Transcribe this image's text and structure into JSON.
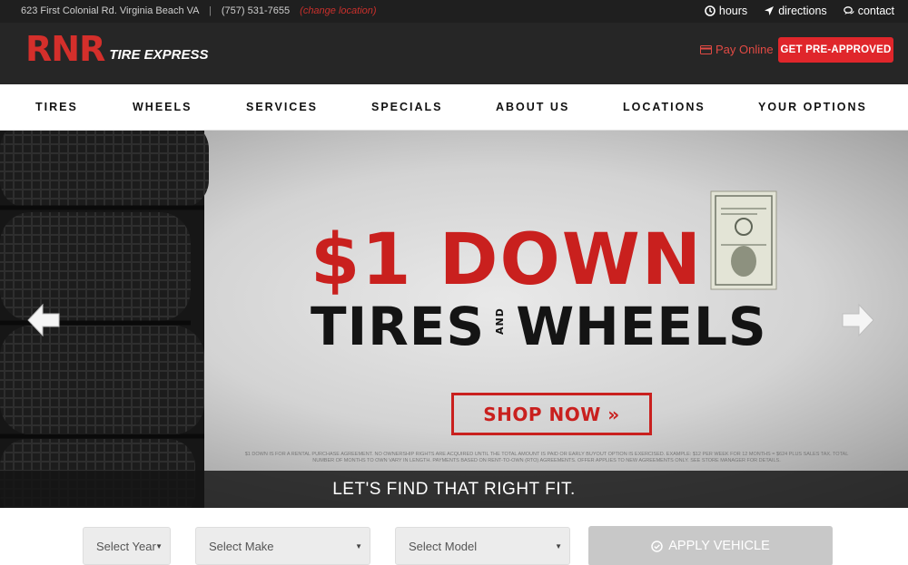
{
  "topbar": {
    "address": "623 First Colonial Rd. Virginia Beach VA",
    "separator": "|",
    "phone": "(757) 531-7655",
    "change_location": "(change location)",
    "links": [
      {
        "label": "hours",
        "icon": "clock-icon"
      },
      {
        "label": "directions",
        "icon": "location-arrow-icon"
      },
      {
        "label": "contact",
        "icon": "chat-icon"
      }
    ]
  },
  "header": {
    "logo_mark": "RNR",
    "logo_text": "TIRE EXPRESS",
    "pay_online": "Pay Online",
    "pre_approved": "GET PRE-APPROVED"
  },
  "nav": {
    "items": [
      "TIRES",
      "WHEELS",
      "SERVICES",
      "SPECIALS",
      "ABOUT US",
      "LOCATIONS",
      "YOUR OPTIONS"
    ]
  },
  "hero": {
    "headline_1": "$1 DOWN",
    "headline_2a": "TIRES",
    "headline_and": "AND",
    "headline_2b": "WHEELS",
    "cta": "SHOP NOW »",
    "fineprint": "$1 DOWN IS FOR A RENTAL PURCHASE AGREEMENT. NO OWNERSHIP RIGHTS ARE ACQUIRED UNTIL THE TOTAL AMOUNT IS PAID OR EARLY BUYOUT OPTION IS EXERCISED. EXAMPLE: $12 PER WEEK FOR 12 MONTHS = $624 PLUS SALES TAX. TOTAL NUMBER OF MONTHS TO OWN VARY IN LENGTH. PAYMENTS BASED ON RENT-TO-OWN (RTO) AGREEMENTS. OFFER APPLIES TO NEW AGREEMENTS ONLY. SEE STORE MANAGER FOR DETAILS.",
    "fit_banner": "LET'S FIND THAT RIGHT FIT."
  },
  "selector": {
    "year": "Select Year",
    "make": "Select Make",
    "model": "Select Model",
    "apply": "APPLY VEHICLE"
  },
  "colors": {
    "brand_red": "#e0262b",
    "header_dark": "#262626",
    "topbar_dark": "#1f1f1f"
  }
}
